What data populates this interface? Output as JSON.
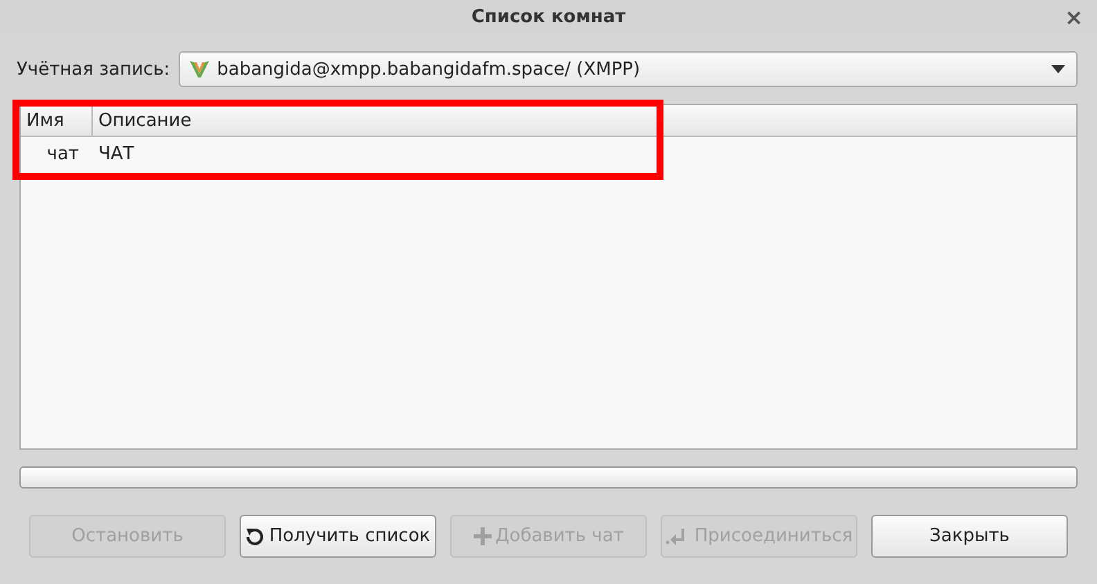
{
  "window": {
    "title": "Список комнат",
    "close": "×"
  },
  "account": {
    "label": "Учётная запись:",
    "value": "babangida@xmpp.babangidafm.space/ (XMPP)"
  },
  "table": {
    "columns": [
      "Имя",
      "Описание"
    ],
    "rows": [
      {
        "name": "чат",
        "description": "ЧАТ"
      }
    ]
  },
  "progress": {
    "level": 0
  },
  "buttons": [
    {
      "label": "Остановить",
      "kind": "plain",
      "disabled": true
    },
    {
      "label": "Получить список",
      "kind": "refresh",
      "disabled": false
    },
    {
      "label": "Добавить чат",
      "kind": "add",
      "disabled": true
    },
    {
      "label": "Присоединиться",
      "kind": "join",
      "disabled": true
    },
    {
      "label": "Закрыть",
      "kind": "plain",
      "disabled": false
    }
  ]
}
